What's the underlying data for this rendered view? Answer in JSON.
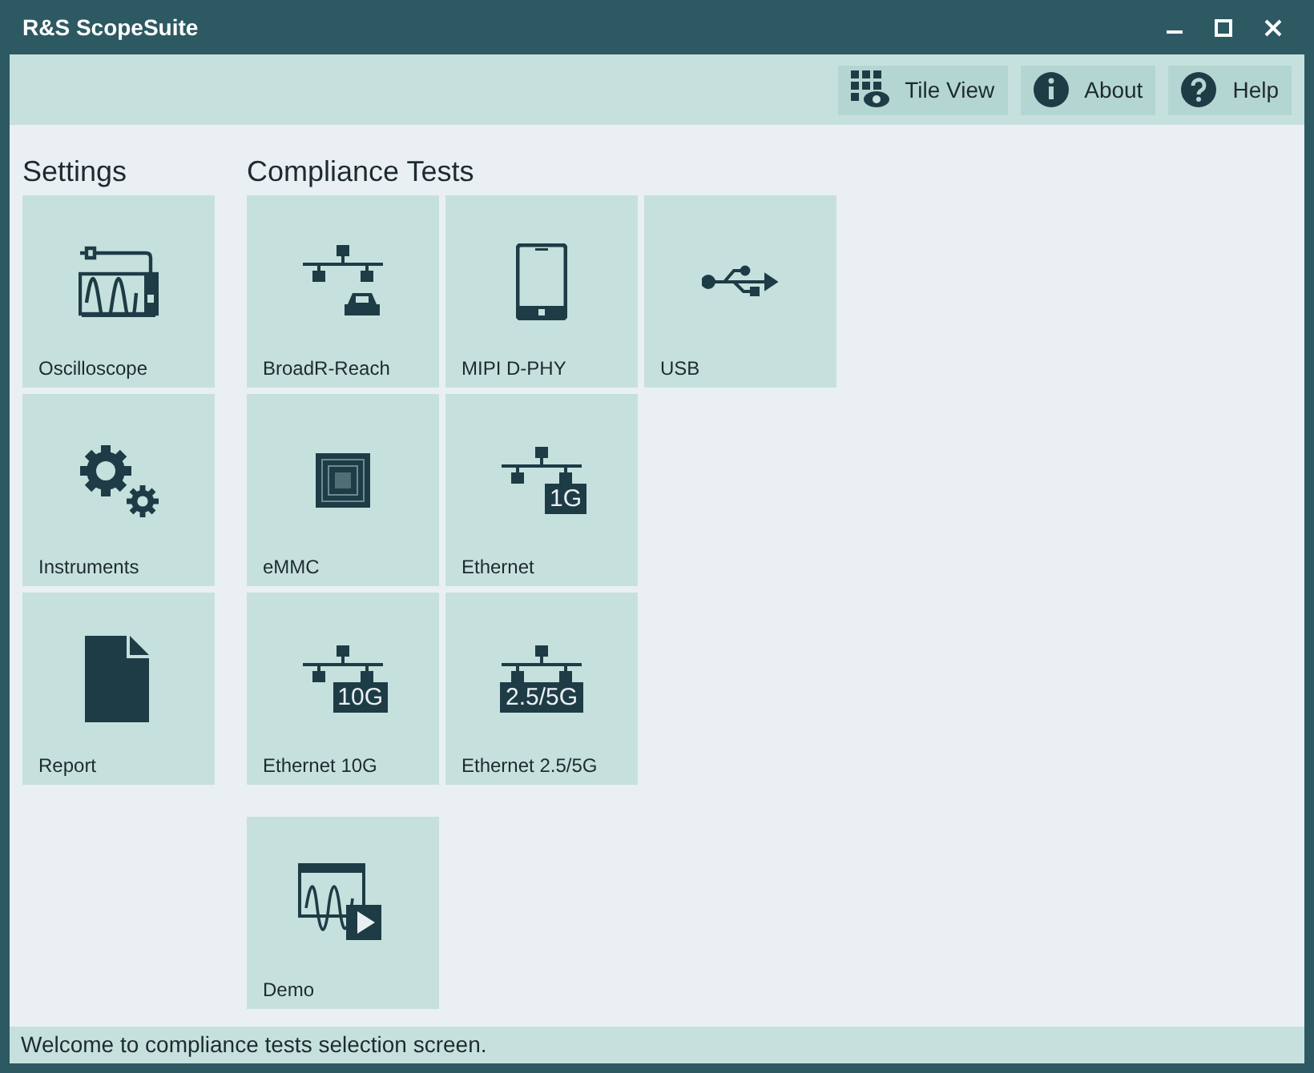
{
  "window": {
    "title": "R&S ScopeSuite"
  },
  "toolbar": [
    {
      "label": "Tile View",
      "kind": "tiles"
    },
    {
      "label": "About",
      "kind": "info"
    },
    {
      "label": "Help",
      "kind": "help"
    }
  ],
  "sections": [
    {
      "title": "Settings",
      "rows": [
        [
          {
            "label": "Oscilloscope",
            "kind": "scope"
          }
        ],
        [
          {
            "label": "Instruments",
            "kind": "gears"
          }
        ],
        [
          {
            "label": "Report",
            "kind": "doc"
          }
        ]
      ]
    },
    {
      "title": "Compliance Tests",
      "rows": [
        [
          {
            "label": "BroadR-Reach",
            "kind": "car"
          },
          {
            "label": "MIPI D-PHY",
            "kind": "phone"
          },
          {
            "label": "USB",
            "kind": "usb"
          }
        ],
        [
          {
            "label": "eMMC",
            "kind": "chip"
          },
          {
            "label": "Ethernet",
            "kind": "net",
            "badge": "1G"
          }
        ],
        [
          {
            "label": "Ethernet 10G",
            "kind": "net",
            "badge": "10G"
          },
          {
            "label": "Ethernet 2.5/5G",
            "kind": "net",
            "badge": "2.5/5G"
          }
        ]
      ],
      "extra": [
        {
          "label": "Demo",
          "kind": "demo"
        }
      ]
    }
  ],
  "status_bar": "Welcome to compliance tests selection screen."
}
